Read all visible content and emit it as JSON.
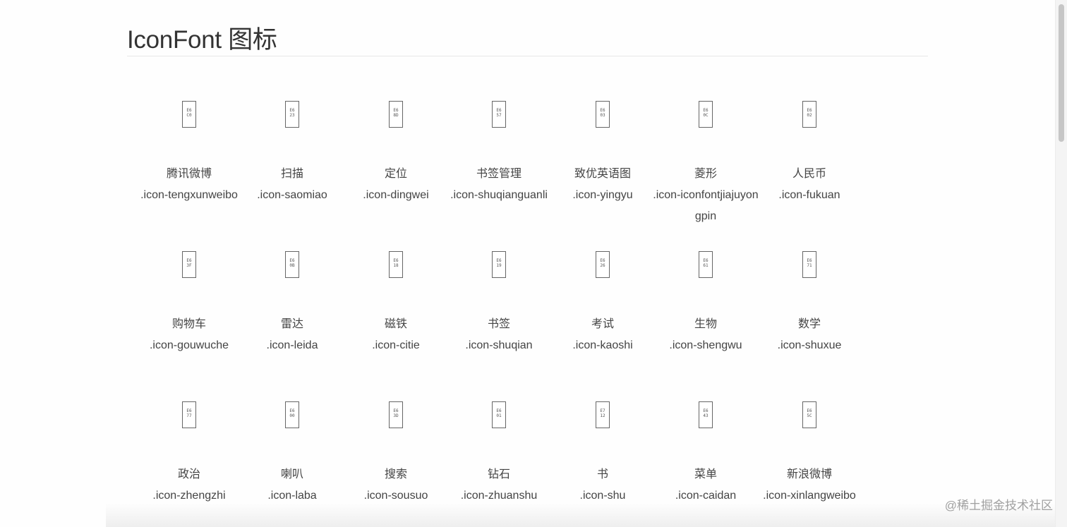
{
  "header": {
    "title": "IconFont 图标"
  },
  "icons": [
    {
      "name": "腾讯微博",
      "class": ".icon-tengxunweibo",
      "code": "E6\nC0"
    },
    {
      "name": "扫描",
      "class": ".icon-saomiao",
      "code": "E6\n23"
    },
    {
      "name": "定位",
      "class": ".icon-dingwei",
      "code": "E6\n8D"
    },
    {
      "name": "书签管理",
      "class": ".icon-shuqianguanli",
      "code": "E6\n57"
    },
    {
      "name": "致优英语图",
      "class": ".icon-yingyu",
      "code": "E6\n03"
    },
    {
      "name": "菱形",
      "class": ".icon-iconfontjiajuyongpin",
      "code": "E6\n0C"
    },
    {
      "name": "人民币",
      "class": ".icon-fukuan",
      "code": "E6\n02"
    },
    {
      "name": "购物车",
      "class": ".icon-gouwuche",
      "code": "E6\n3F"
    },
    {
      "name": "雷达",
      "class": ".icon-leida",
      "code": "E6\n0B"
    },
    {
      "name": "磁铁",
      "class": ".icon-citie",
      "code": "E6\n18"
    },
    {
      "name": "书签",
      "class": ".icon-shuqian",
      "code": "E6\n19"
    },
    {
      "name": "考试",
      "class": ".icon-kaoshi",
      "code": "E6\n26"
    },
    {
      "name": "生物",
      "class": ".icon-shengwu",
      "code": "E6\n61"
    },
    {
      "name": "数学",
      "class": ".icon-shuxue",
      "code": "E6\n71"
    },
    {
      "name": "政治",
      "class": ".icon-zhengzhi",
      "code": "E6\n77"
    },
    {
      "name": "喇叭",
      "class": ".icon-laba",
      "code": "E6\n00"
    },
    {
      "name": "搜索",
      "class": ".icon-sousuo",
      "code": "E6\n3D"
    },
    {
      "name": "钻石",
      "class": ".icon-zhuanshu",
      "code": "E6\n01"
    },
    {
      "name": "书",
      "class": ".icon-shu",
      "code": "E7\n12"
    },
    {
      "name": "菜单",
      "class": ".icon-caidan",
      "code": "E6\n43"
    },
    {
      "name": "新浪微博",
      "class": ".icon-xinlangweibo",
      "code": "E6\n5C"
    }
  ],
  "watermark": "@稀土掘金技术社区"
}
